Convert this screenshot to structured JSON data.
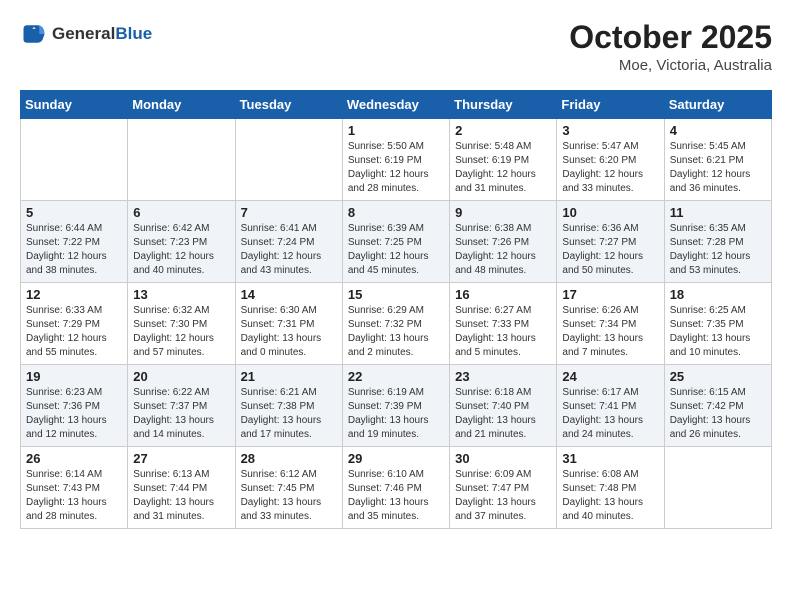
{
  "header": {
    "logo_general": "General",
    "logo_blue": "Blue",
    "month": "October 2025",
    "location": "Moe, Victoria, Australia"
  },
  "weekdays": [
    "Sunday",
    "Monday",
    "Tuesday",
    "Wednesday",
    "Thursday",
    "Friday",
    "Saturday"
  ],
  "weeks": [
    [
      {
        "day": "",
        "info": ""
      },
      {
        "day": "",
        "info": ""
      },
      {
        "day": "",
        "info": ""
      },
      {
        "day": "1",
        "info": "Sunrise: 5:50 AM\nSunset: 6:19 PM\nDaylight: 12 hours\nand 28 minutes."
      },
      {
        "day": "2",
        "info": "Sunrise: 5:48 AM\nSunset: 6:19 PM\nDaylight: 12 hours\nand 31 minutes."
      },
      {
        "day": "3",
        "info": "Sunrise: 5:47 AM\nSunset: 6:20 PM\nDaylight: 12 hours\nand 33 minutes."
      },
      {
        "day": "4",
        "info": "Sunrise: 5:45 AM\nSunset: 6:21 PM\nDaylight: 12 hours\nand 36 minutes."
      }
    ],
    [
      {
        "day": "5",
        "info": "Sunrise: 6:44 AM\nSunset: 7:22 PM\nDaylight: 12 hours\nand 38 minutes."
      },
      {
        "day": "6",
        "info": "Sunrise: 6:42 AM\nSunset: 7:23 PM\nDaylight: 12 hours\nand 40 minutes."
      },
      {
        "day": "7",
        "info": "Sunrise: 6:41 AM\nSunset: 7:24 PM\nDaylight: 12 hours\nand 43 minutes."
      },
      {
        "day": "8",
        "info": "Sunrise: 6:39 AM\nSunset: 7:25 PM\nDaylight: 12 hours\nand 45 minutes."
      },
      {
        "day": "9",
        "info": "Sunrise: 6:38 AM\nSunset: 7:26 PM\nDaylight: 12 hours\nand 48 minutes."
      },
      {
        "day": "10",
        "info": "Sunrise: 6:36 AM\nSunset: 7:27 PM\nDaylight: 12 hours\nand 50 minutes."
      },
      {
        "day": "11",
        "info": "Sunrise: 6:35 AM\nSunset: 7:28 PM\nDaylight: 12 hours\nand 53 minutes."
      }
    ],
    [
      {
        "day": "12",
        "info": "Sunrise: 6:33 AM\nSunset: 7:29 PM\nDaylight: 12 hours\nand 55 minutes."
      },
      {
        "day": "13",
        "info": "Sunrise: 6:32 AM\nSunset: 7:30 PM\nDaylight: 12 hours\nand 57 minutes."
      },
      {
        "day": "14",
        "info": "Sunrise: 6:30 AM\nSunset: 7:31 PM\nDaylight: 13 hours\nand 0 minutes."
      },
      {
        "day": "15",
        "info": "Sunrise: 6:29 AM\nSunset: 7:32 PM\nDaylight: 13 hours\nand 2 minutes."
      },
      {
        "day": "16",
        "info": "Sunrise: 6:27 AM\nSunset: 7:33 PM\nDaylight: 13 hours\nand 5 minutes."
      },
      {
        "day": "17",
        "info": "Sunrise: 6:26 AM\nSunset: 7:34 PM\nDaylight: 13 hours\nand 7 minutes."
      },
      {
        "day": "18",
        "info": "Sunrise: 6:25 AM\nSunset: 7:35 PM\nDaylight: 13 hours\nand 10 minutes."
      }
    ],
    [
      {
        "day": "19",
        "info": "Sunrise: 6:23 AM\nSunset: 7:36 PM\nDaylight: 13 hours\nand 12 minutes."
      },
      {
        "day": "20",
        "info": "Sunrise: 6:22 AM\nSunset: 7:37 PM\nDaylight: 13 hours\nand 14 minutes."
      },
      {
        "day": "21",
        "info": "Sunrise: 6:21 AM\nSunset: 7:38 PM\nDaylight: 13 hours\nand 17 minutes."
      },
      {
        "day": "22",
        "info": "Sunrise: 6:19 AM\nSunset: 7:39 PM\nDaylight: 13 hours\nand 19 minutes."
      },
      {
        "day": "23",
        "info": "Sunrise: 6:18 AM\nSunset: 7:40 PM\nDaylight: 13 hours\nand 21 minutes."
      },
      {
        "day": "24",
        "info": "Sunrise: 6:17 AM\nSunset: 7:41 PM\nDaylight: 13 hours\nand 24 minutes."
      },
      {
        "day": "25",
        "info": "Sunrise: 6:15 AM\nSunset: 7:42 PM\nDaylight: 13 hours\nand 26 minutes."
      }
    ],
    [
      {
        "day": "26",
        "info": "Sunrise: 6:14 AM\nSunset: 7:43 PM\nDaylight: 13 hours\nand 28 minutes."
      },
      {
        "day": "27",
        "info": "Sunrise: 6:13 AM\nSunset: 7:44 PM\nDaylight: 13 hours\nand 31 minutes."
      },
      {
        "day": "28",
        "info": "Sunrise: 6:12 AM\nSunset: 7:45 PM\nDaylight: 13 hours\nand 33 minutes."
      },
      {
        "day": "29",
        "info": "Sunrise: 6:10 AM\nSunset: 7:46 PM\nDaylight: 13 hours\nand 35 minutes."
      },
      {
        "day": "30",
        "info": "Sunrise: 6:09 AM\nSunset: 7:47 PM\nDaylight: 13 hours\nand 37 minutes."
      },
      {
        "day": "31",
        "info": "Sunrise: 6:08 AM\nSunset: 7:48 PM\nDaylight: 13 hours\nand 40 minutes."
      },
      {
        "day": "",
        "info": ""
      }
    ]
  ]
}
